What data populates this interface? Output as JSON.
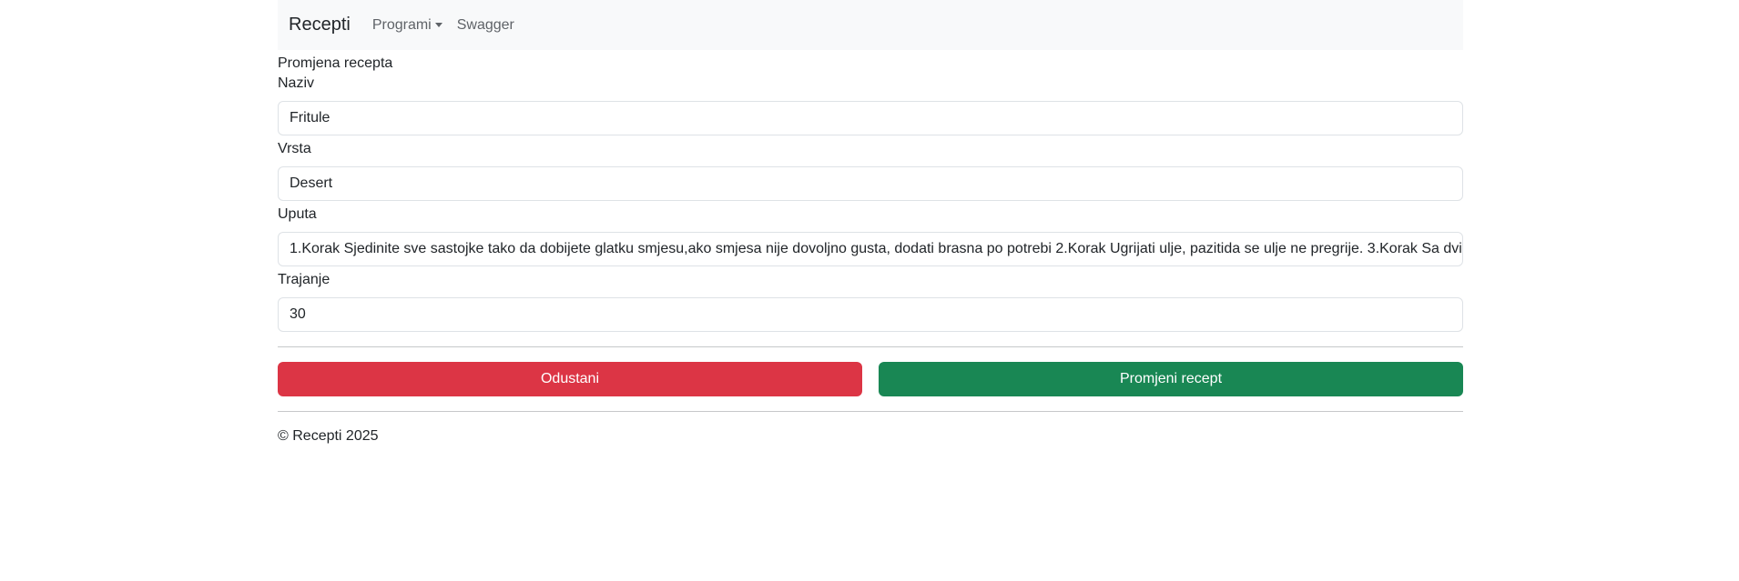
{
  "nav": {
    "brand": "Recepti",
    "programs": "Programi",
    "swagger": "Swagger"
  },
  "page": {
    "heading": "Promjena recepta"
  },
  "form": {
    "naziv_label": "Naziv",
    "naziv_value": "Fritule",
    "vrsta_label": "Vrsta",
    "vrsta_value": "Desert",
    "uputa_label": "Uputa",
    "uputa_value": "1.Korak Sjedinite sve sastojke tako da dobijete glatku smjesu,ako smjesa nije dovoljno gusta, dodati brasna po potrebi 2.Korak Ugrijati ulje, pazitida se ulje ne pregrije. 3.Korak Sa dvi",
    "trajanje_label": "Trajanje",
    "trajanje_value": "30"
  },
  "buttons": {
    "cancel": "Odustani",
    "submit": "Promjeni recept"
  },
  "footer": {
    "text": "© Recepti 2025"
  },
  "colors": {
    "navbar_bg": "#f8f9fa",
    "cancel": "#dc3545",
    "submit": "#198754"
  }
}
